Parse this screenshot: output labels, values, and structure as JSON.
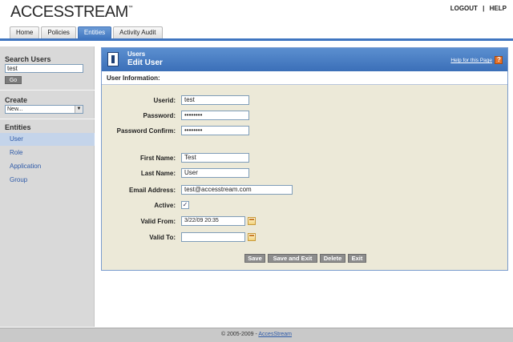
{
  "app": {
    "logo": "ACCESSTREAM",
    "logo_tm": "™"
  },
  "header": {
    "logout": "LOGOUT",
    "sep": "|",
    "help": "HELP",
    "tabs": [
      {
        "label": "Home"
      },
      {
        "label": "Policies"
      },
      {
        "label": "Entities",
        "active": true
      },
      {
        "label": "Activity Audit"
      }
    ]
  },
  "sidebar": {
    "search_title": "Search Users",
    "search_value": "test",
    "go_label": "Go",
    "create_title": "Create",
    "create_selected": "New...",
    "entities_title": "Entities",
    "entities": [
      {
        "label": "User",
        "selected": true
      },
      {
        "label": "Role"
      },
      {
        "label": "Application"
      },
      {
        "label": "Group"
      }
    ]
  },
  "panel": {
    "crumb": "Users",
    "title": "Edit User",
    "help_link": "Help for this Page",
    "section_title": "User Information:",
    "fields": {
      "userid_label": "Userid:",
      "userid_value": "test",
      "password_label": "Password:",
      "password_value": "••••••••",
      "confirm_label": "Password Confirm:",
      "confirm_value": "••••••••",
      "first_label": "First Name:",
      "first_value": "Test",
      "last_label": "Last Name:",
      "last_value": "User",
      "email_label": "Email Address:",
      "email_value": "test@accesstream.com",
      "active_label": "Active:",
      "active_checked": true,
      "active_mark": "✓",
      "valid_from_label": "Valid From:",
      "valid_from_value": "3/22/09 20:35",
      "valid_to_label": "Valid To:",
      "valid_to_value": ""
    },
    "buttons": {
      "save": "Save",
      "save_exit": "Save and Exit",
      "delete": "Delete",
      "exit": "Exit"
    }
  },
  "footer": {
    "copyright": "© 2005-2009 -",
    "link": "AccesStream"
  },
  "colors": {
    "accent": "#3f75c0",
    "panel_bg": "#ece9d8",
    "sidebar_bg": "#d9d9d9"
  }
}
